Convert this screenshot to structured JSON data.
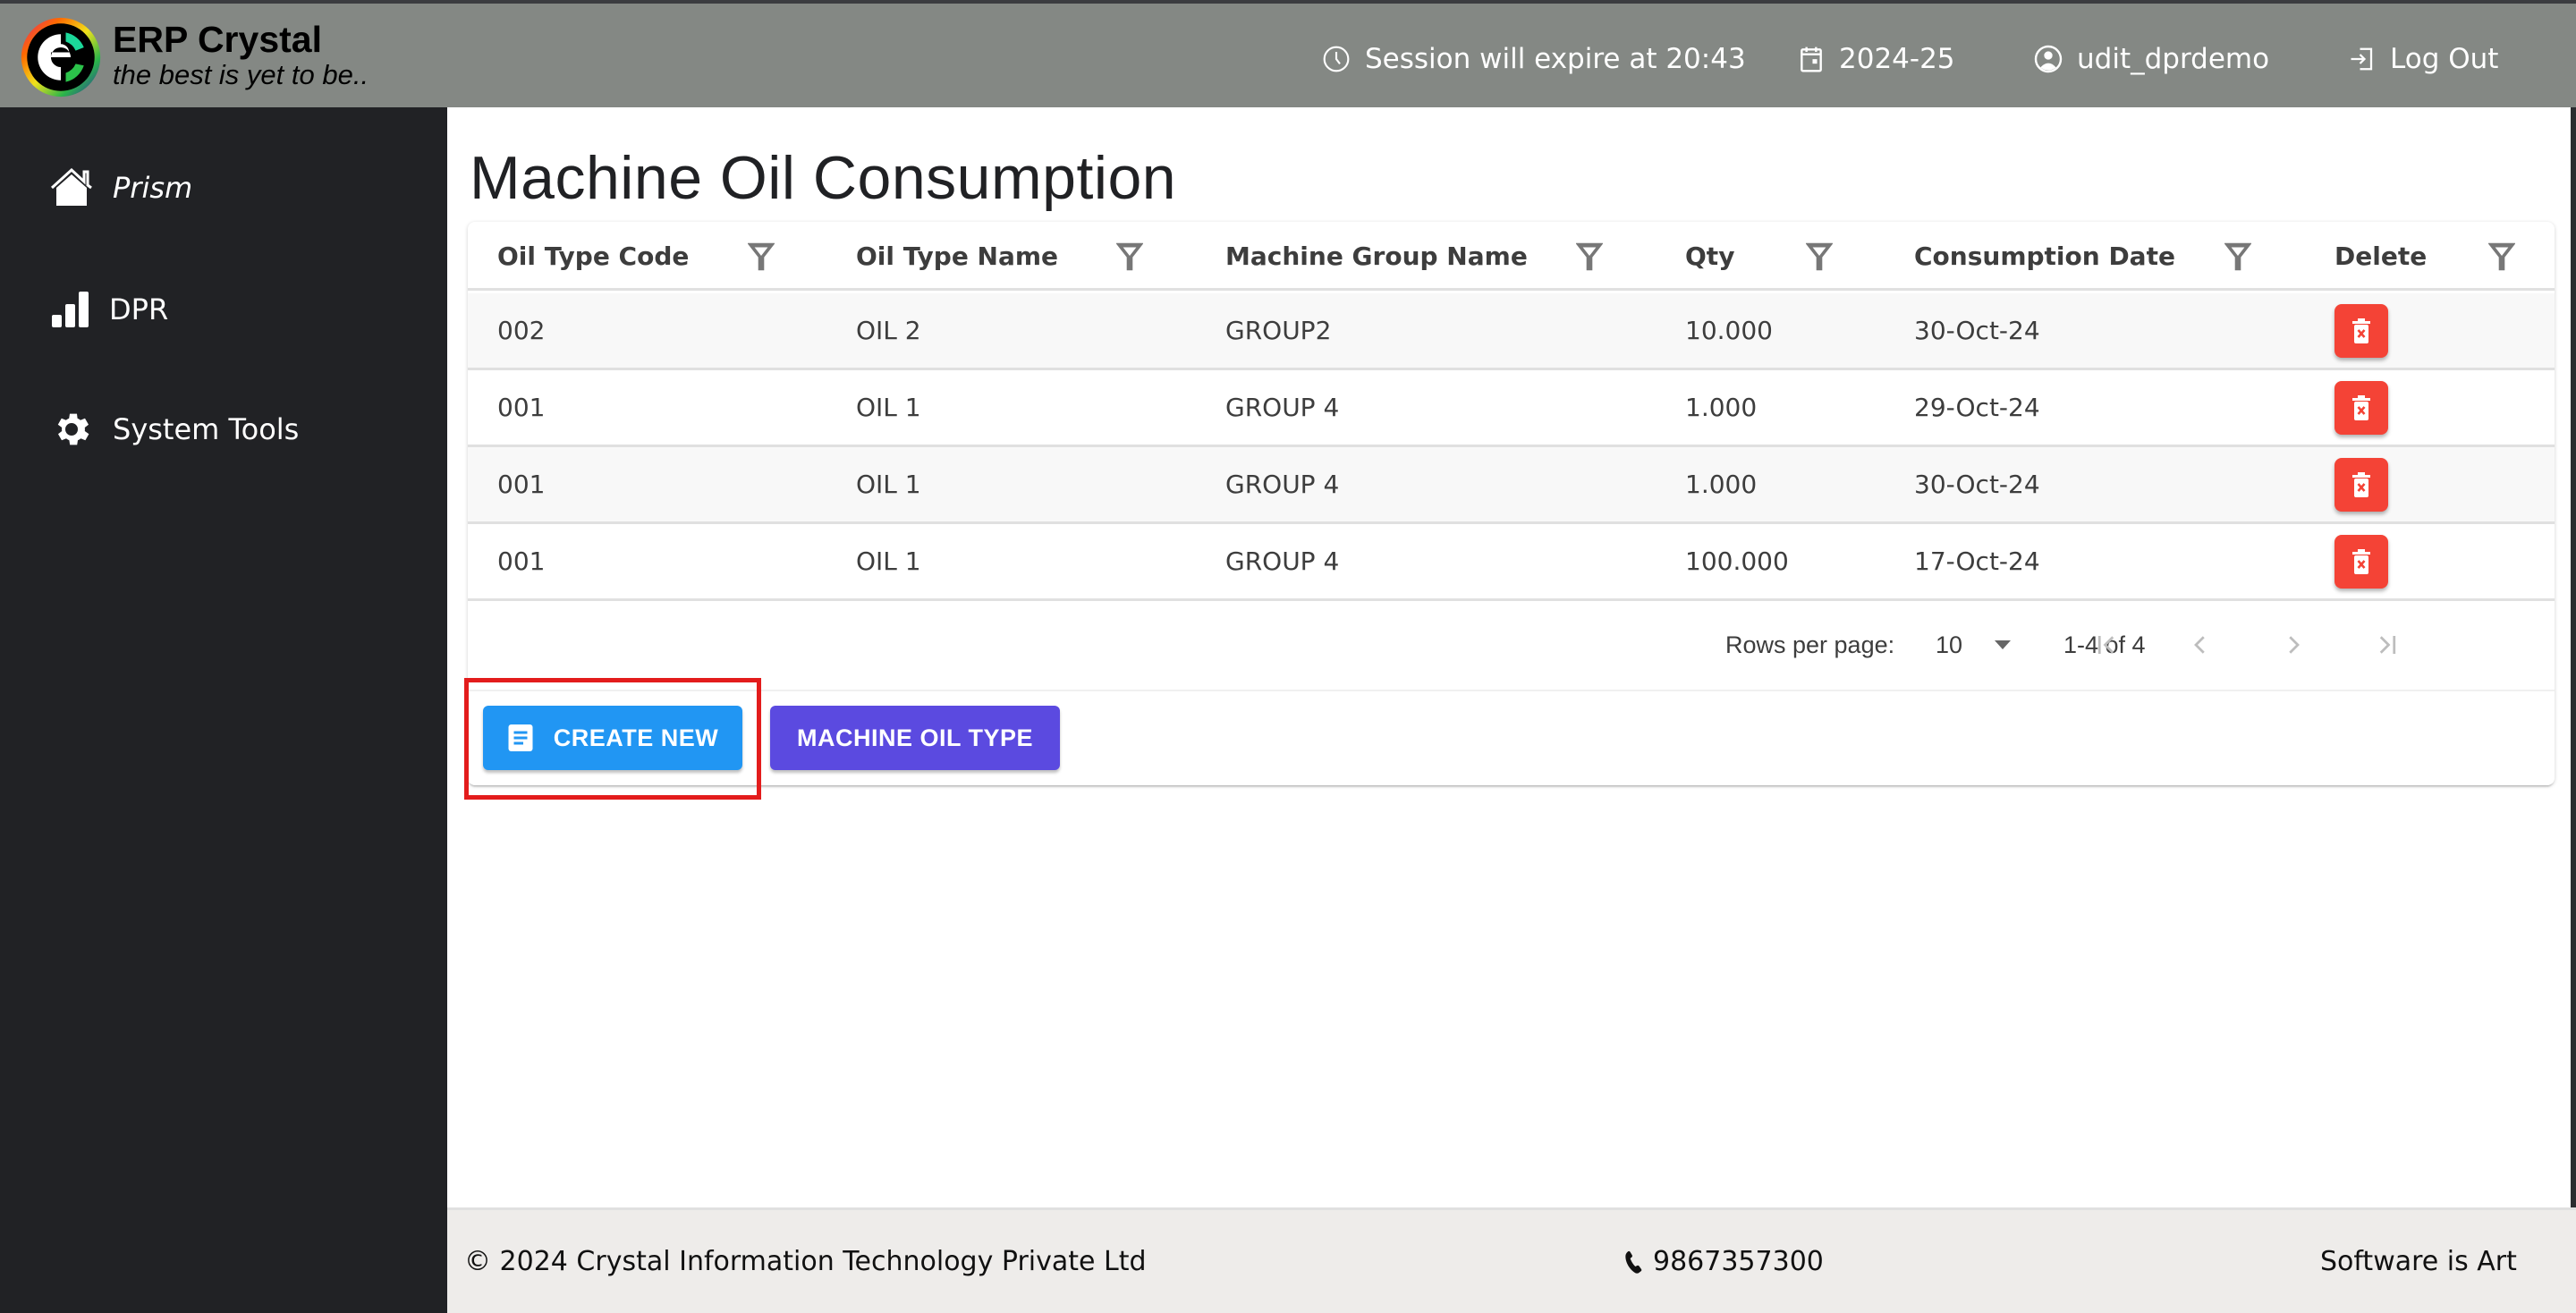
{
  "header": {
    "brand_name": "ERP Crystal",
    "brand_tagline": "the best is yet to be..",
    "session_text": "Session will expire at 20:43",
    "financial_year": "2024-25",
    "username": "udit_dprdemo",
    "logout_label": "Log Out",
    "icons": [
      "clock-icon",
      "calendar-icon",
      "user-circle-icon",
      "logout-icon"
    ]
  },
  "sidebar": {
    "items": [
      {
        "label": "Prism",
        "icon": "home-icon"
      },
      {
        "label": "DPR",
        "icon": "bar-chart-icon"
      },
      {
        "label": "System Tools",
        "icon": "gear-icon"
      }
    ]
  },
  "page": {
    "title": "Machine Oil Consumption"
  },
  "table": {
    "columns": [
      "Oil Type Code",
      "Oil Type Name",
      "Machine Group Name",
      "Qty",
      "Consumption Date",
      "Delete"
    ],
    "rows": [
      {
        "oil_type_code": "002",
        "oil_type_name": "OIL 2",
        "machine_group_name": "GROUP2",
        "qty": "10.000",
        "consumption_date": "30-Oct-24"
      },
      {
        "oil_type_code": "001",
        "oil_type_name": "OIL 1",
        "machine_group_name": "GROUP 4",
        "qty": "1.000",
        "consumption_date": "29-Oct-24"
      },
      {
        "oil_type_code": "001",
        "oil_type_name": "OIL 1",
        "machine_group_name": "GROUP 4",
        "qty": "1.000",
        "consumption_date": "30-Oct-24"
      },
      {
        "oil_type_code": "001",
        "oil_type_name": "OIL 1",
        "machine_group_name": "GROUP 4",
        "qty": "100.000",
        "consumption_date": "17-Oct-24"
      }
    ],
    "pagination": {
      "rows_per_page_label": "Rows per page:",
      "rows_per_page_value": "10",
      "range_text": "1-4 of 4"
    }
  },
  "actions": {
    "create_new_label": "CREATE NEW",
    "machine_oil_type_label": "MACHINE OIL TYPE"
  },
  "footer": {
    "copyright": "© 2024 Crystal Information Technology Private Ltd",
    "phone": "9867357300",
    "motto": "Software is Art"
  },
  "colors": {
    "header_bg": "#848884",
    "sidebar_bg": "#212225",
    "delete_red": "#f44336",
    "create_blue": "#2196f3",
    "oil_type_purple": "#5b4ae0",
    "highlight_red": "#e31c1c",
    "footer_bg": "#eeecea"
  }
}
